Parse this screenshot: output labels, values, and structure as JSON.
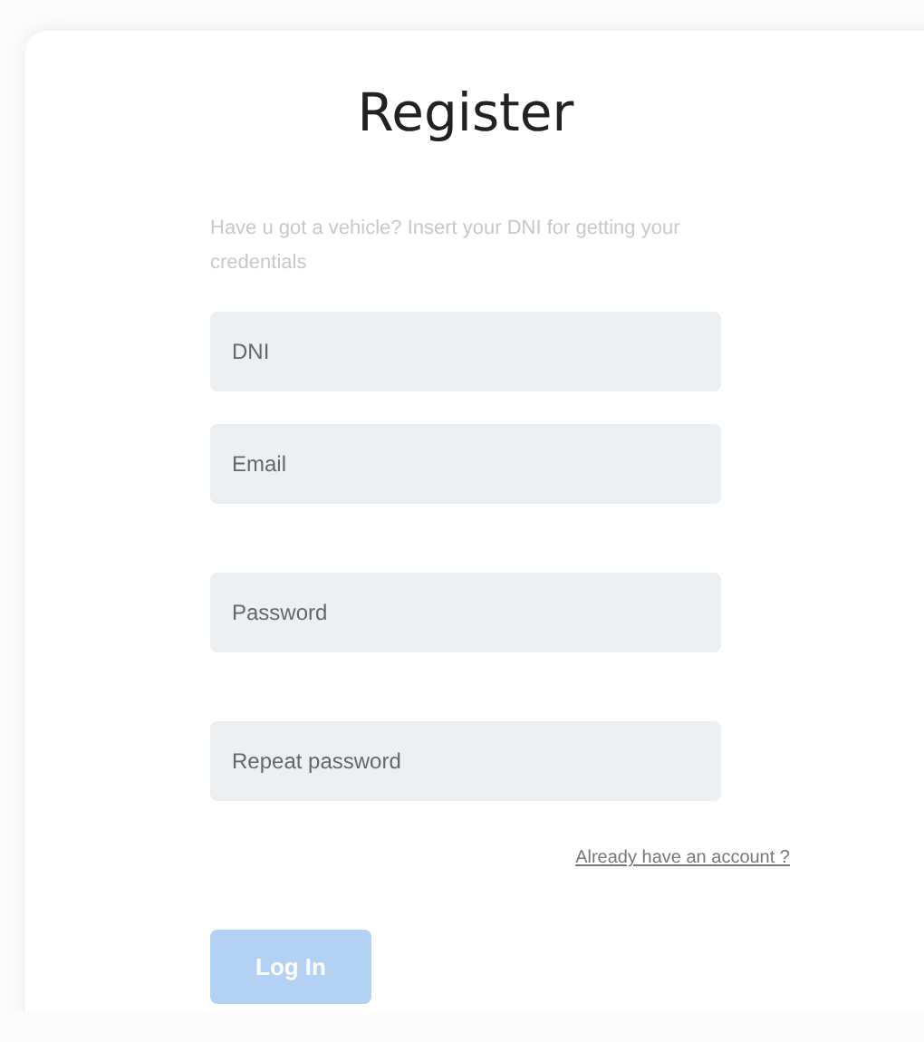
{
  "title": "Register",
  "subtitle": "Have u got a vehicle? Insert your DNI for getting your credentials",
  "fields": [
    {
      "placeholder": "DNI"
    },
    {
      "placeholder": "Email"
    },
    {
      "placeholder": "Password"
    },
    {
      "placeholder": "Repeat password"
    }
  ],
  "link": "Already have an account ?",
  "button": {
    "label": "Log In",
    "disabled": true
  }
}
